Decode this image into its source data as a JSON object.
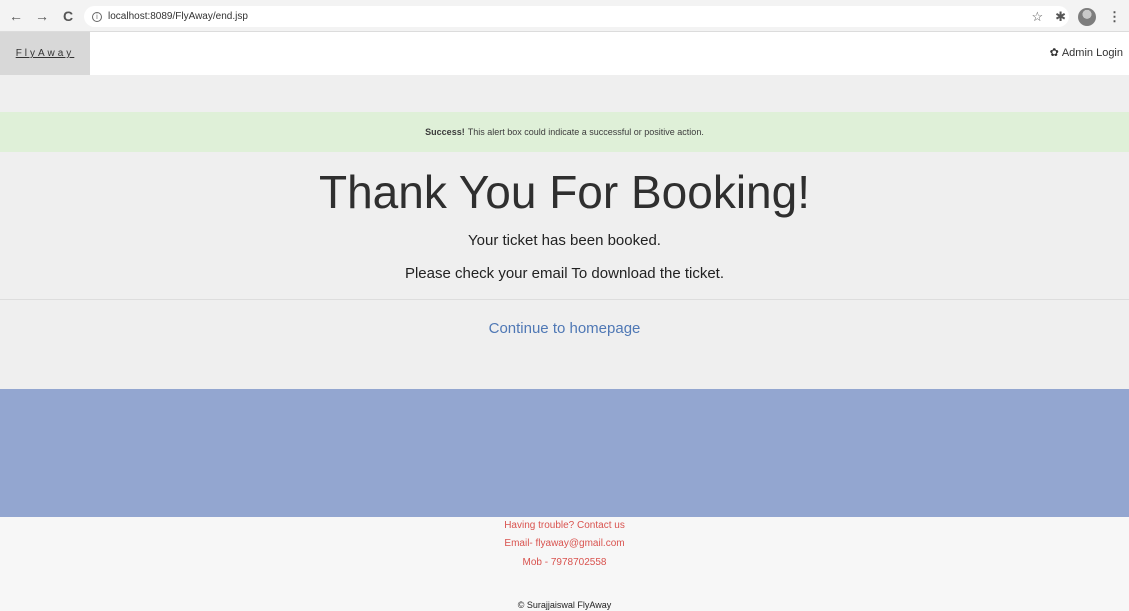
{
  "browser": {
    "url": "localhost:8089/FlyAway/end.jsp",
    "back_icon": "←",
    "forward_icon": "→",
    "reload_icon": "C",
    "info_icon": "i",
    "star_icon": "☆",
    "extension_icon": "✱",
    "menu_icon": "⋮"
  },
  "navbar": {
    "brand": "FlyAway",
    "admin_login": "Admin Login",
    "gear_icon": "✿"
  },
  "alert": {
    "strong": "Success!",
    "text": "This alert box could indicate a successful or positive action."
  },
  "main": {
    "heading": "Thank You For Booking!",
    "line1": "Your ticket has been booked.",
    "line2": "Please check your email To download the ticket.",
    "continue_link": "Continue to homepage"
  },
  "footer": {
    "line1": "Having trouble? Contact us",
    "line2": "Email- flyaway@gmail.com",
    "line3": "Mob - 7978702558",
    "copyright": "© Surajjaiswal FlyAway"
  },
  "colors": {
    "alert_bg": "#dff0d8",
    "band": "#93a6d0",
    "link": "#4f78b5",
    "footer_text": "#d9534f"
  }
}
